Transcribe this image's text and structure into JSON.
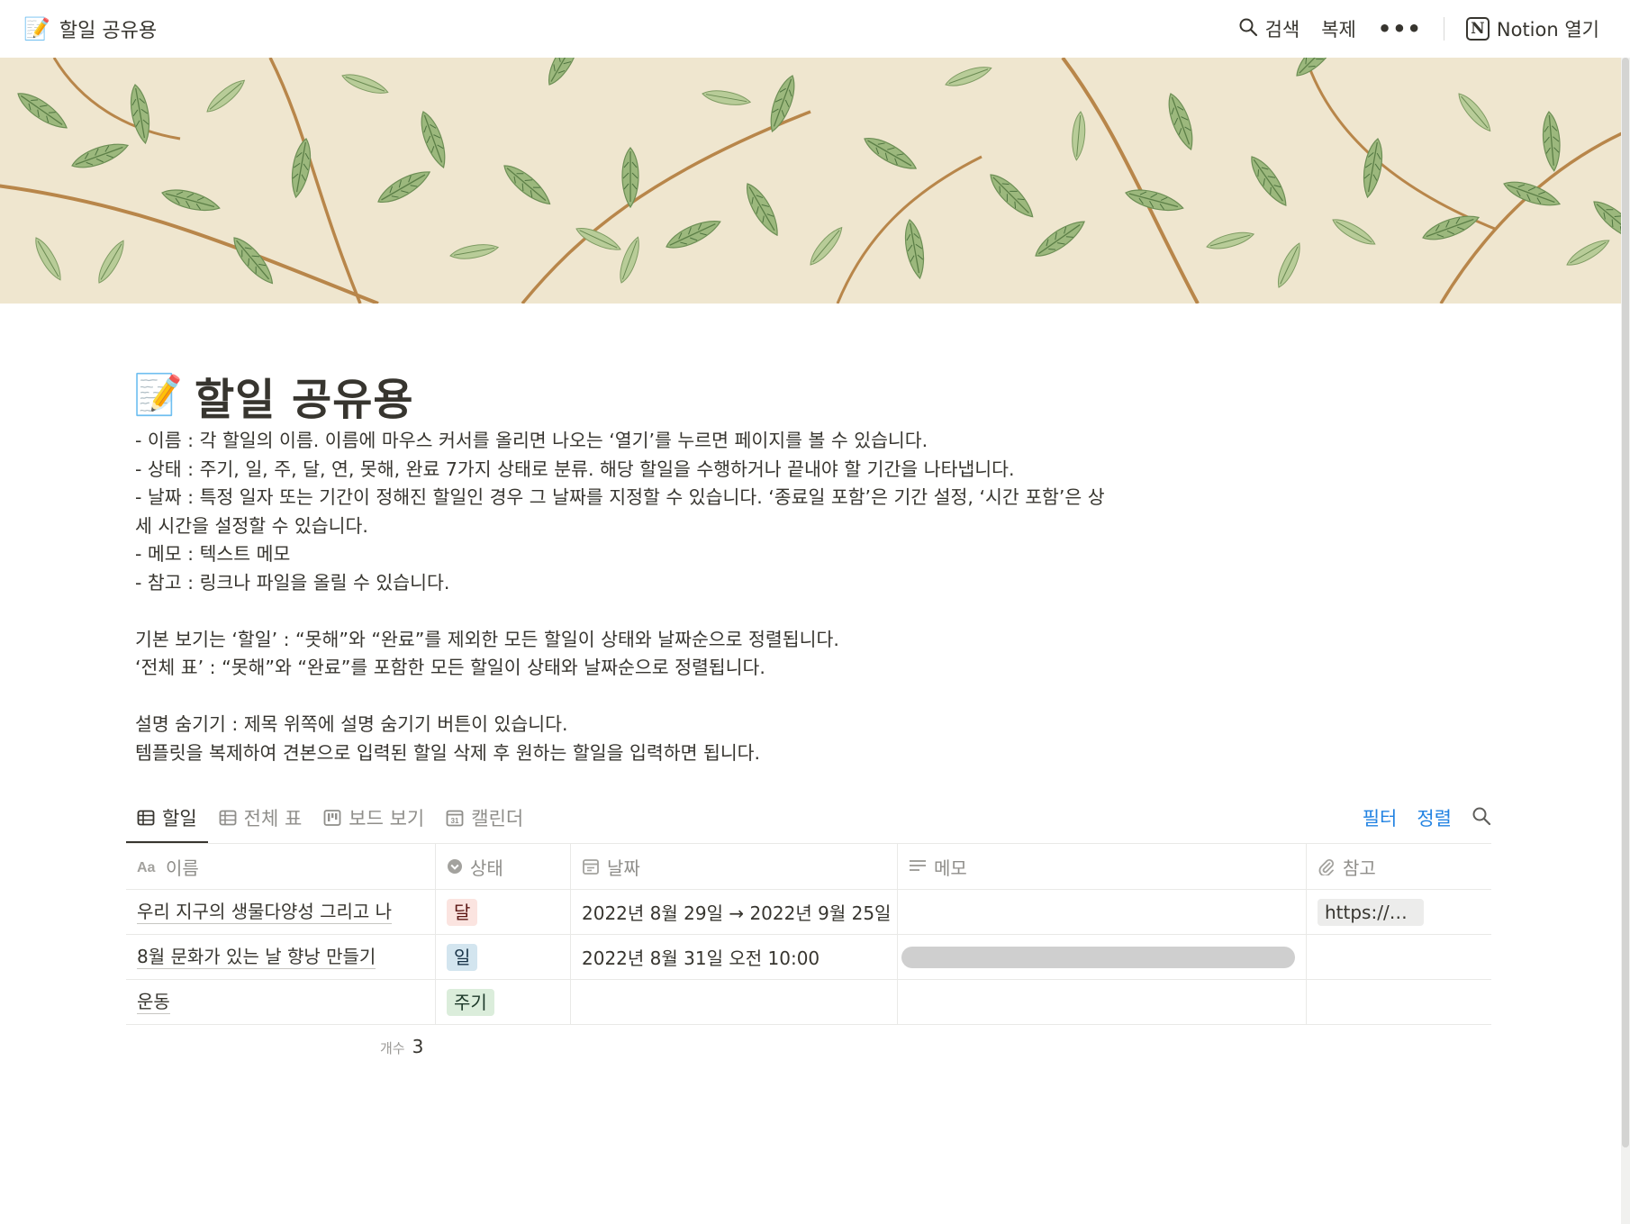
{
  "topbar": {
    "breadcrumb_icon": "memo-emoji",
    "breadcrumb_emoji": "📝",
    "breadcrumb_title": "할일 공유용",
    "search_label": "검색",
    "duplicate_label": "복제",
    "more_label": "•••",
    "open_in_notion_label": "Notion 열기"
  },
  "cover": {
    "pattern": "willow-leaves",
    "background": "#efe6cf"
  },
  "page": {
    "icon_emoji": "📝",
    "title": "할일 공유용",
    "description_lines": [
      "- 이름 : 각 할일의 이름. 이름에 마우스 커서를 올리면 나오는 ‘열기’를 누르면 페이지를 볼 수 있습니다.",
      "- 상태 : 주기, 일, 주, 달, 연, 못해, 완료 7가지 상태로 분류. 해당 할일을 수행하거나 끝내야 할 기간을 나타냅니다.",
      "- 날짜 : 특정 일자 또는 기간이 정해진 할일인 경우 그 날짜를 지정할 수 있습니다. ‘종료일 포함’은 기간 설정, ‘시간 포함’은 상",
      "세 시간을 설정할 수 있습니다.",
      "- 메모 : 텍스트 메모",
      "- 참고 : 링크나 파일을 올릴 수 있습니다.",
      "",
      "기본 보기는 ‘할일’ : “못해”와 “완료”를 제외한 모든 할일이 상태와 날짜순으로 정렬됩니다.",
      "‘전체 표’ : “못해”와 “완료”를 포함한 모든 할일이 상태와 날짜순으로 정렬됩니다.",
      "",
      "설명 숨기기 : 제목 위쪽에 설명 숨기기 버튼이 있습니다.",
      "템플릿을 복제하여 견본으로 입력된 할일 삭제 후 원하는 할일을 입력하면 됩니다."
    ]
  },
  "views": {
    "tabs": [
      {
        "label": "할일",
        "icon": "table-icon",
        "active": true
      },
      {
        "label": "전체 표",
        "icon": "table-icon",
        "active": false
      },
      {
        "label": "보드 보기",
        "icon": "board-icon",
        "active": false
      },
      {
        "label": "캘린더",
        "icon": "calendar-icon",
        "active": false
      }
    ],
    "filter_label": "필터",
    "sort_label": "정렬",
    "accent_color": "#2383e2"
  },
  "table": {
    "columns": [
      {
        "label": "이름",
        "icon": "title-aa-icon"
      },
      {
        "label": "상태",
        "icon": "select-icon"
      },
      {
        "label": "날짜",
        "icon": "date-icon"
      },
      {
        "label": "메모",
        "icon": "text-icon"
      },
      {
        "label": "참고",
        "icon": "attachment-icon"
      }
    ],
    "rows": [
      {
        "name": "우리 지구의 생물다양성 그리고 나",
        "status": {
          "label": "달",
          "bg": "#fbe4e0",
          "color": "#5d1715"
        },
        "date": "2022년 8월 29일 → 2022년 9월 25일",
        "memo": "",
        "ref": "https://w..."
      },
      {
        "name": "8월 문화가 있는 날 향낭 만들기",
        "status": {
          "label": "일",
          "bg": "#d3e5ef",
          "color": "#183347"
        },
        "date": "2022년 8월 31일 오전 10:00",
        "memo_redacted": true,
        "ref": ""
      },
      {
        "name": "운동",
        "status": {
          "label": "주기",
          "bg": "#dbeddb",
          "color": "#1c3829"
        },
        "date": "",
        "memo": "",
        "ref": ""
      }
    ],
    "count_label": "개수",
    "count_value": "3"
  }
}
